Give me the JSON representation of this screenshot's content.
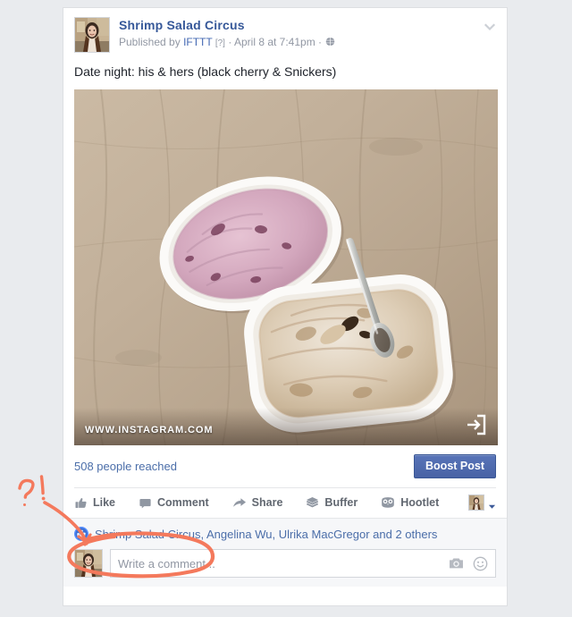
{
  "colors": {
    "page_background": "#e9ebee",
    "card_background": "#ffffff",
    "link_blue": "#365899",
    "meta_gray": "#9197a3",
    "boost_button_blue": "#4c69ba",
    "annotation_orange": "#f4795c",
    "likes_section_background": "#f6f7f9",
    "action_label_gray": "#616770"
  },
  "post": {
    "page_name": "Shrimp Salad Circus",
    "published_prefix": "Published by",
    "publisher": "IFTTT",
    "publisher_help": "[?]",
    "separator": "·",
    "timestamp": "April 8 at 7:41pm",
    "privacy_icon": "globe-icon",
    "options_icon": "chevron-down-icon",
    "caption": "Date night: his & hers (black cherry & Snickers)",
    "avatar_icon": "profile-photo-avatar"
  },
  "photo": {
    "alt": "Two open ice cream tubs on a light wooden table, pink black cherry on the upper left and beige Snickers on the lower right, each with a metal spoon",
    "watermark": "WWW.INSTAGRAM.COM",
    "link_icon": "external-link-icon"
  },
  "insights": {
    "reach_text": "508 people reached",
    "boost_label": "Boost Post"
  },
  "actions": [
    {
      "label": "Like",
      "icon": "thumbs-up-icon"
    },
    {
      "label": "Comment",
      "icon": "speech-bubble-icon"
    },
    {
      "label": "Share",
      "icon": "share-arrow-icon"
    },
    {
      "label": "Buffer",
      "icon": "buffer-layers-icon"
    },
    {
      "label": "Hootlet",
      "icon": "hootsuite-owl-icon"
    }
  ],
  "account_switcher": {
    "avatar_icon": "mini-profile-avatar",
    "caret_icon": "caret-down-icon"
  },
  "likes": {
    "badge_icon": "like-badge-icon",
    "names": "Shrimp Salad Circus, Angelina Wu, Ulrika MacGregor and 2 others"
  },
  "comment_box": {
    "avatar_icon": "commenter-avatar",
    "placeholder": "Write a comment...",
    "camera_icon": "camera-icon",
    "emoji_icon": "emoji-smiley-icon"
  },
  "annotation": {
    "marker_text": "?!",
    "shapes": [
      "question-exclamation-mark",
      "curved-arrow",
      "ellipse-highlight"
    ],
    "target": "likes-names-row"
  }
}
